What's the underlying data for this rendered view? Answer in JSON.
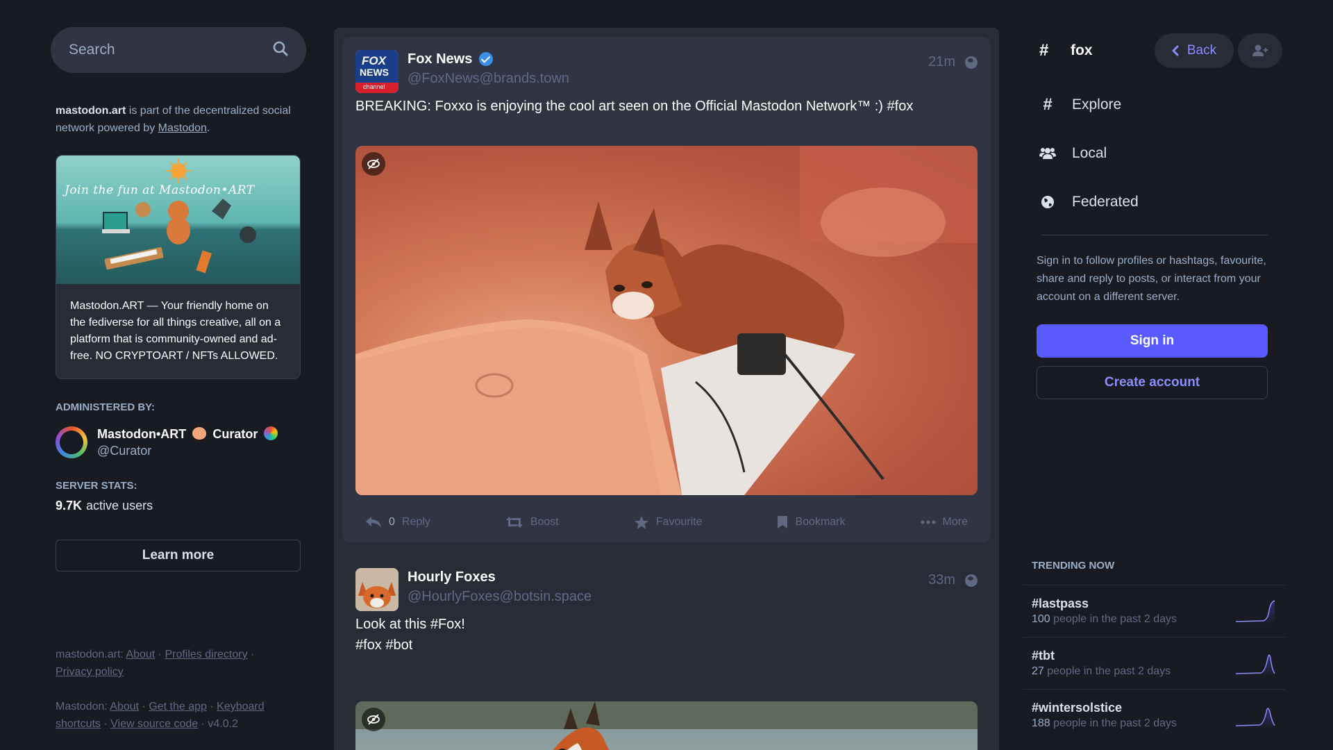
{
  "search": {
    "placeholder": "Search"
  },
  "about": {
    "server": "mastodon.art",
    "text_mid": " is part of the decentralized social network powered by ",
    "link": "Mastodon",
    "text_end": "."
  },
  "hero": {
    "banner_text": "Join the fun at Mastodon•ART",
    "description": "Mastodon.ART — Your friendly home on the fediverse for all things creative, all on a platform that is community-owned and ad-free. NO CRYPTOART / NFTs ALLOWED."
  },
  "admin": {
    "label": "ADMINISTERED BY:",
    "name_part1": "Mastodon•ART",
    "name_part2": "Curator",
    "handle": "@Curator"
  },
  "stats": {
    "label": "SERVER STATS:",
    "value": "9.7K",
    "unit": "active users"
  },
  "learn_more": "Learn more",
  "footer": {
    "line1_prefix": "mastodon.art",
    "line1_links": [
      "About",
      "Profiles directory",
      "Privacy policy"
    ],
    "line2_prefix": "Mastodon",
    "line2_links": [
      "About",
      "Get the app",
      "Keyboard shortcuts",
      "View source code"
    ],
    "version": "v4.0.2"
  },
  "posts": [
    {
      "name": "Fox News",
      "handle": "@FoxNews@brands.town",
      "time": "21m",
      "text": "BREAKING: Foxxo is enjoying the cool art seen on the Official Mastodon Network™ :) #fox",
      "avatar_text": [
        "FOX",
        "NEWS",
        "channel"
      ],
      "actions": {
        "reply_count": "0",
        "reply": "Reply",
        "boost": "Boost",
        "favourite": "Favourite",
        "bookmark": "Bookmark",
        "more": "More"
      }
    },
    {
      "name": "Hourly Foxes",
      "handle": "@HourlyFoxes@botsin.space",
      "time": "33m",
      "text_line1": "Look at this #Fox!",
      "text_line2": "#fox #bot"
    }
  ],
  "column": {
    "hash": "#",
    "title": "fox",
    "back": "Back"
  },
  "nav": [
    "Explore",
    "Local",
    "Federated"
  ],
  "signin": {
    "text": "Sign in to follow profiles or hashtags, favourite, share and reply to posts, or interact from your account on a different server.",
    "sign_in": "Sign in",
    "create": "Create account"
  },
  "trending": {
    "title": "TRENDING NOW",
    "items": [
      {
        "tag": "#lastpass",
        "count": "100",
        "suffix": " people in the past 2 days"
      },
      {
        "tag": "#tbt",
        "count": "27",
        "suffix": " people in the past 2 days"
      },
      {
        "tag": "#wintersolstice",
        "count": "188",
        "suffix": " people in the past 2 days"
      }
    ]
  },
  "colors": {
    "accent": "#595aff",
    "accent_text": "#8c8dff",
    "bg": "#191b22",
    "panel": "#282c37"
  }
}
